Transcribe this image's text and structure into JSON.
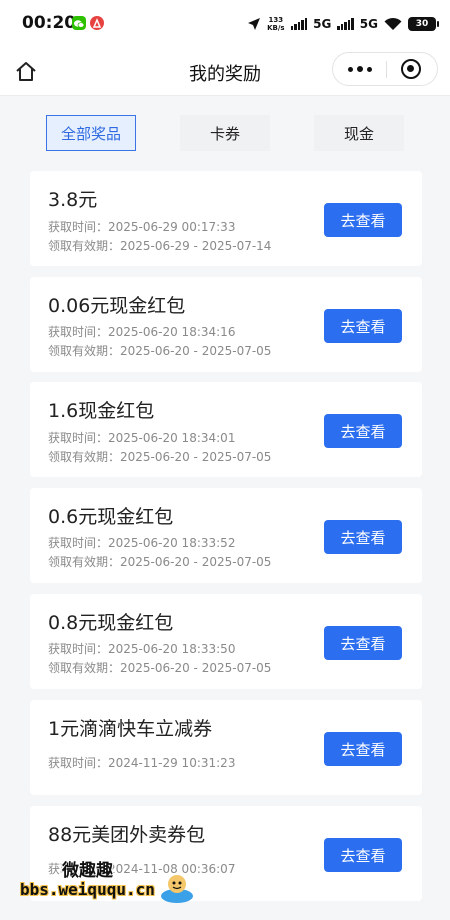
{
  "status_bar": {
    "time": "00:20",
    "net_speed_value": "133",
    "net_speed_unit": "KB/s",
    "network_1": "5G",
    "network_2": "5G",
    "battery": "30",
    "icons": [
      "wechat-icon",
      "app-notification-icon",
      "location-arrow-icon",
      "signal-icon",
      "wifi-icon",
      "battery-icon"
    ]
  },
  "nav": {
    "title": "我的奖励",
    "home_icon": "home-icon",
    "more_icon": "more-dots-icon",
    "close_icon": "mini-program-close-icon"
  },
  "tabs": [
    {
      "label": "全部奖品",
      "active": true
    },
    {
      "label": "卡券",
      "active": false
    },
    {
      "label": "现金",
      "active": false
    }
  ],
  "rewards": [
    {
      "title": "3.8元",
      "obtained": "获取时间：2025-06-29 00:17:33",
      "validity": "领取有效期：2025-06-29 - 2025-07-14",
      "button": "去查看"
    },
    {
      "title": "0.06元现金红包",
      "obtained": "获取时间：2025-06-20 18:34:16",
      "validity": "领取有效期：2025-06-20 - 2025-07-05",
      "button": "去查看"
    },
    {
      "title": "1.6现金红包",
      "obtained": "获取时间：2025-06-20 18:34:01",
      "validity": "领取有效期：2025-06-20 - 2025-07-05",
      "button": "去查看"
    },
    {
      "title": "0.6元现金红包",
      "obtained": "获取时间：2025-06-20 18:33:52",
      "validity": "领取有效期：2025-06-20 - 2025-07-05",
      "button": "去查看"
    },
    {
      "title": "0.8元现金红包",
      "obtained": "获取时间：2025-06-20 18:33:50",
      "validity": "领取有效期：2025-06-20 - 2025-07-05",
      "button": "去查看"
    },
    {
      "title": "1元滴滴快车立减券",
      "obtained": "获取时间：2024-11-29 10:31:23",
      "button": "去查看"
    },
    {
      "title": "88元美团外卖券包",
      "obtained": "获取时间：2024-11-08 00:36:07",
      "button": "去查看"
    }
  ],
  "watermark": {
    "name": "微趣趣",
    "url": "bbs.weiququ.cn"
  },
  "colors": {
    "accent": "#2b6ef0",
    "tab_active_bg": "#e6effd",
    "tab_active_border": "#3b74e6",
    "page_bg": "#f5f6f8"
  }
}
